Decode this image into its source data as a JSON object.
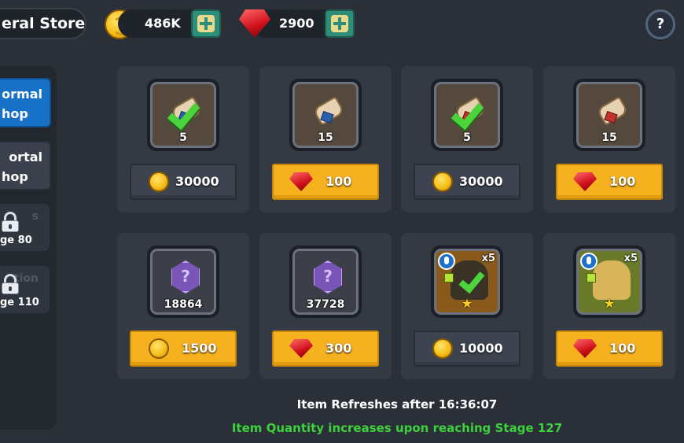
{
  "header": {
    "title": "eral Store",
    "currencies": [
      {
        "icon": "gold-coin-icon",
        "amount": "486K"
      },
      {
        "icon": "ruby-gem-icon",
        "amount": "2900"
      }
    ],
    "help_label": "?"
  },
  "sidebar": {
    "tabs": [
      {
        "line1": "ormal",
        "line2": "hop",
        "active": true
      },
      {
        "line1": "ortal",
        "line2": "hop",
        "active": false
      }
    ],
    "locked": [
      {
        "ghost": "s",
        "stage": "ge 80"
      },
      {
        "ghost": "tion",
        "stage": "ge 110"
      }
    ]
  },
  "items": [
    {
      "icon": "scroll-check-icon",
      "quantity": "5",
      "price": "30000",
      "currency": "coin"
    },
    {
      "icon": "blue-scroll-icon",
      "quantity": "15",
      "price": "100",
      "currency": "ruby"
    },
    {
      "icon": "scroll-check-icon",
      "quantity": "5",
      "price": "30000",
      "currency": "coin"
    },
    {
      "icon": "red-scroll-icon",
      "quantity": "15",
      "price": "100",
      "currency": "ruby"
    },
    {
      "icon": "purple-stone-icon",
      "quantity": "18864",
      "price": "1500",
      "currency": "coin"
    },
    {
      "icon": "purple-stone-icon",
      "quantity": "37728",
      "price": "300",
      "currency": "ruby"
    },
    {
      "icon": "hero-warrior-icon",
      "multiplier": "x5",
      "price": "10000",
      "currency": "coin"
    },
    {
      "icon": "hero-elf-icon",
      "multiplier": "x5",
      "price": "100",
      "currency": "ruby"
    }
  ],
  "footer": {
    "refresh_text": "Item Refreshes after 16:36:07",
    "quantity_text": "Item Quantity increases upon reaching Stage 127",
    "quantity_color": "#3dd13d"
  },
  "colors": {
    "background": "#2b3038",
    "card": "#343a44",
    "gold_button": "#f6b11f",
    "dark_button": "#3d4450",
    "active_tab": "#1671c7",
    "plus_button": "#2d8f7a"
  }
}
